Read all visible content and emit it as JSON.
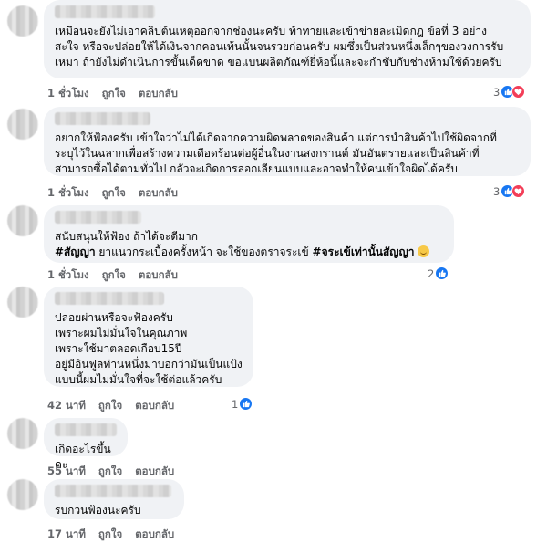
{
  "comments": [
    {
      "lines": "เหมือนจะยังไม่เอาคลิปต้นเหตุออกจากช่องนะครับ ท้าทายและเข้าข่ายละเมิดกฎ ข้อที่ 3 อย่าง\nสะใจ หรือจะปล่อยให้ได้เงินจากคอนเท้นนั้นจนรวยก่อนครับ ผมซึ่งเป็นส่วนหนึ่งเล็กๆของวงการรับ\nเหมา ถ้ายังไม่ดำเนินการขั้นเด็ดขาด ขอแบนผลิตภัณฑ์ยี่ห้อนี้และจะกำชับกับช่างห้ามใช้ด้วยครับ",
      "time": "1 ชั่วโมง",
      "like": "ถูกใจ",
      "reply": "ตอบกลับ",
      "reaction_count": "3"
    },
    {
      "lines": "อยากให้ฟ้องครับ เข้าใจว่าไม่ได้เกิดจากความผิดพลาดของสินค้า แต่การนำสินค้าไปใช้ผิดจากที่\nระบุไว้ในฉลากเพื่อสร้างความเดือดร้อนต่อผู้อื่นในงานสงกรานต์ มันอันตรายและเป็นสินค้าที่\nสามารถซื้อได้ตามทั่วไป กลัวจะเกิดการลอกเลียนแบบและอาจทำให้คนเข้าใจผิดได้ครับ",
      "time": "1 ชั่วโมง",
      "like": "ถูกใจ",
      "reply": "ตอบกลับ",
      "reaction_count": "3"
    },
    {
      "line1": "สนับสนุนให้ฟ้อง ถ้าได้จะดีมาก",
      "hashtag1": "#สัญญา",
      "line2_mid": " ยาแนวกระเบื้องครั้งหน้า จะใช้ของตราจระเข้ ",
      "hashtag2": "#จระเข้เท่านั้นสัญญา",
      "time": "1 ชั่วโมง",
      "like": "ถูกใจ",
      "reply": "ตอบกลับ",
      "reaction_count": "2"
    },
    {
      "lines": "ปล่อยผ่านหรือจะฟ้องครับ\nเพราะผมไม่มั่นใจในคุณภาพ\nเพราะใช้มาตลอดเกือบ15ปี\nอยู่มีอินฟูลท่านหนึ่งมาบอกว่ามันเป็นแป้ง\nแบบนี้ผมไม่มั่นใจที่จะใช้ต่อแล้วครับ",
      "time": "42 นาที",
      "like": "ถูกใจ",
      "reply": "ตอบกลับ",
      "reaction_count": "1"
    },
    {
      "lines": "เกิดอะไรขึ้นคะ",
      "time": "55 นาที",
      "like": "ถูกใจ",
      "reply": "ตอบกลับ"
    },
    {
      "lines": "รบกวนฟ้องนะครับ",
      "time": "17 นาที",
      "like": "ถูกใจ",
      "reply": "ตอบกลับ"
    }
  ],
  "icons": {
    "like": "like-reaction-icon",
    "love": "love-reaction-icon",
    "emoji": "smiling-face-icon"
  },
  "colors": {
    "bubble": "#f0f2f5",
    "meta": "#65676b",
    "like_blue": "#1877f2",
    "love_red": "#f33e58"
  }
}
